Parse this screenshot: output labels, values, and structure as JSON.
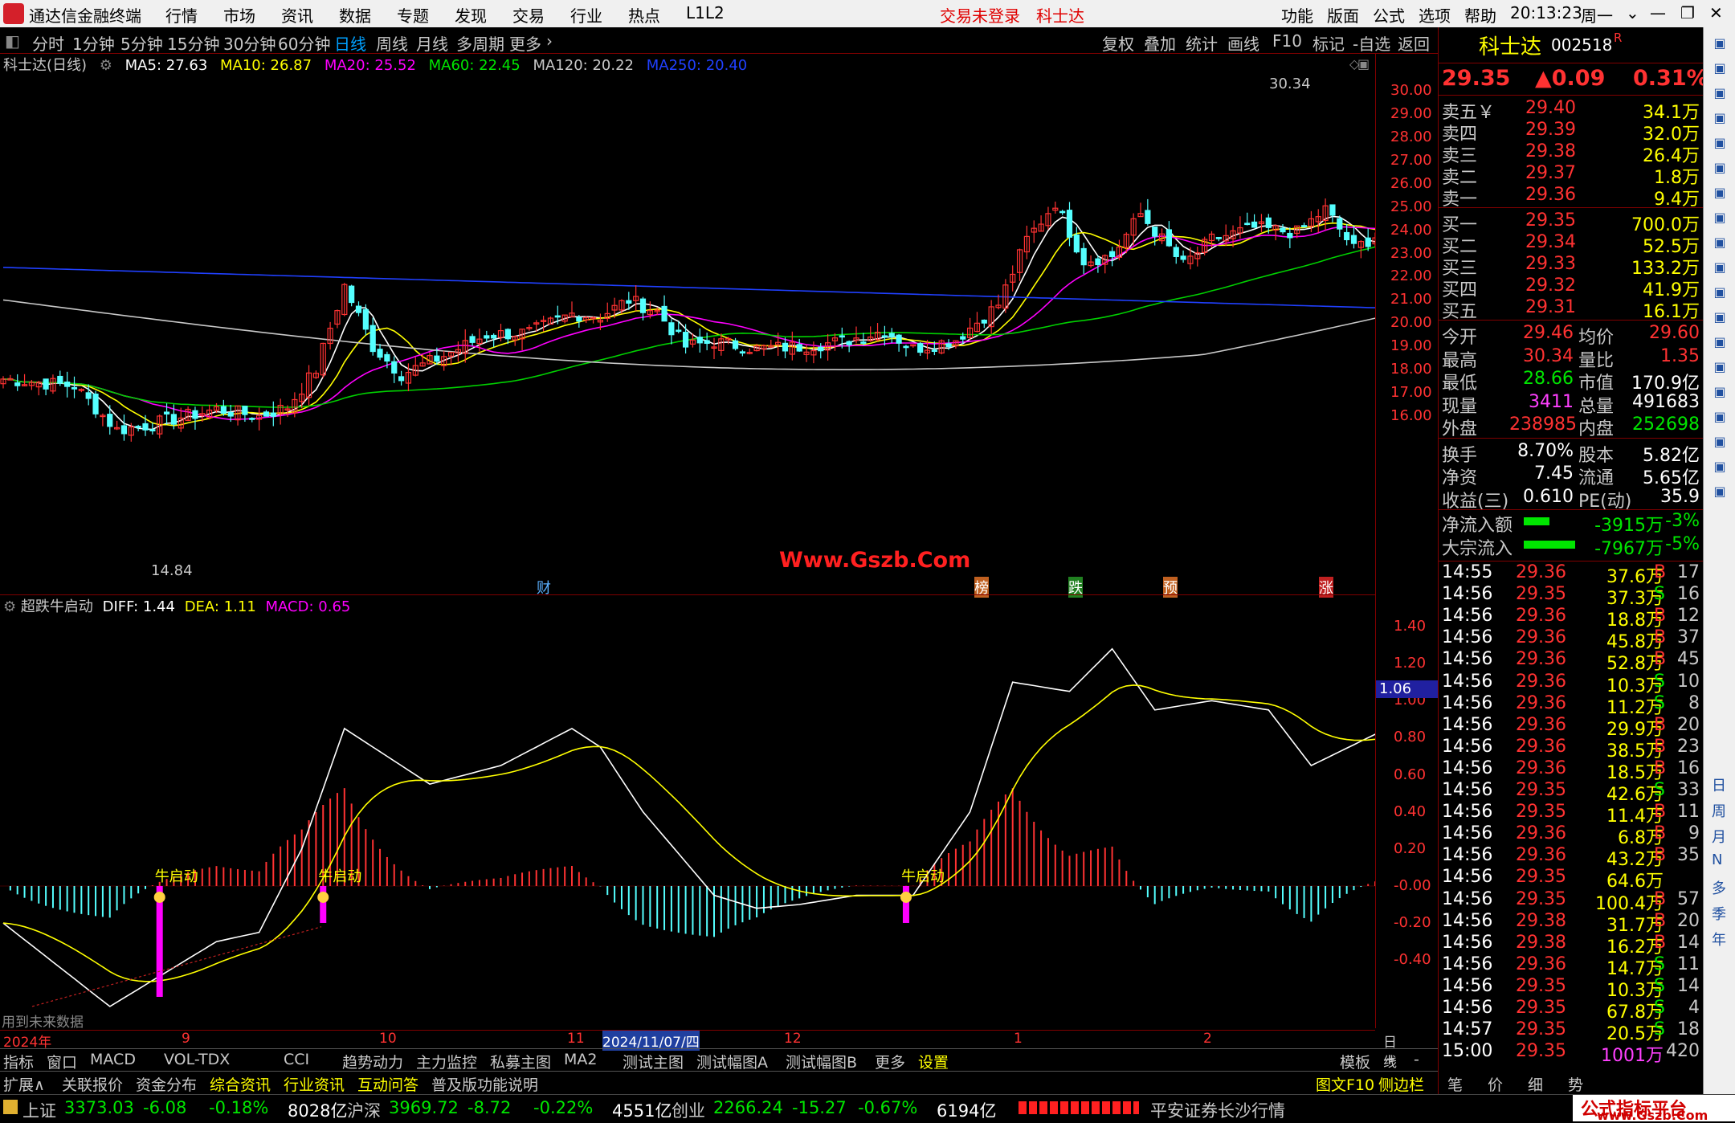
{
  "app": {
    "title": "通达信金融终端",
    "menu": [
      "行情",
      "市场",
      "资讯",
      "数据",
      "专题",
      "发现",
      "交易",
      "行业",
      "热点",
      "L1L2"
    ],
    "status_red": [
      "交易未登录",
      "科士达"
    ],
    "right_menu": [
      "功能",
      "版面",
      "公式",
      "选项",
      "帮助"
    ],
    "time": "20:13:23",
    "weekday": "周一"
  },
  "toolbar": {
    "periods": [
      "分时",
      "1分钟",
      "5分钟",
      "15分钟",
      "30分钟",
      "60分钟",
      "日线",
      "周线",
      "月线",
      "多周期",
      "更多"
    ],
    "active": "日线",
    "tools": [
      "复权",
      "叠加",
      "统计",
      "画线",
      "F10",
      "标记",
      "-自选",
      "返回"
    ]
  },
  "ma": {
    "name": "科士达(日线)",
    "ma5": "MA5: 27.63",
    "ma10": "MA10: 26.87",
    "ma20": "MA20: 25.52",
    "ma60": "MA60: 22.45",
    "ma120": "MA120: 20.22",
    "ma250": "MA250: 20.40"
  },
  "chart": {
    "high_label": "30.34",
    "low_label": "14.84",
    "watermark": "Www.Gszb.Com",
    "price_ticks": [
      "30.00",
      "29.00",
      "28.00",
      "27.00",
      "26.00",
      "25.00",
      "24.00",
      "23.00",
      "22.00",
      "21.00",
      "20.00",
      "19.00",
      "18.00",
      "17.00",
      "16.00"
    ],
    "markers": [
      "财",
      "榜",
      "跌",
      "预",
      "涨"
    ]
  },
  "indicator": {
    "name": "超跌牛启动",
    "diff": "DIFF: 1.44",
    "dea": "DEA: 1.11",
    "macd": "MACD: 0.65",
    "ticks": [
      "1.40",
      "1.20",
      "1.00",
      "0.80",
      "0.60",
      "0.40",
      "0.20",
      "-0.00",
      "-0.20",
      "-0.40"
    ],
    "current": "1.06",
    "signal": "牛启动",
    "footnote": "用到未来数据"
  },
  "dates": {
    "labels": [
      "2024年",
      "9",
      "10",
      "11",
      "2024/11/07/四",
      "12",
      "1",
      "2"
    ],
    "period": "日线"
  },
  "tabs1": [
    "指标",
    "窗口",
    "MACD",
    "VOL-TDX",
    "CCI",
    "趋势动力",
    "主力监控",
    "私募主图",
    "MA2",
    "测试主图",
    "测试幅图A",
    "测试幅图B",
    "更多",
    "设置"
  ],
  "tabs1_right": [
    "模板",
    "+",
    "-"
  ],
  "tabs2": [
    "扩展∧",
    "关联报价",
    "资金分布",
    "综合资讯",
    "行业资讯",
    "互动问答",
    "普及版功能说明"
  ],
  "tabs2_right": [
    "图文F10",
    "侧边栏《",
    "笔",
    "价",
    "细",
    "势"
  ],
  "stock": {
    "name": "科士达",
    "code": "002518",
    "mark": "R",
    "price": "29.35",
    "change": "▲0.09",
    "pct": "0.31%"
  },
  "asks": [
    {
      "l": "卖五￥",
      "p": "29.40",
      "v": "34.1万"
    },
    {
      "l": "卖四",
      "p": "29.39",
      "v": "32.0万"
    },
    {
      "l": "卖三",
      "p": "29.38",
      "v": "26.4万"
    },
    {
      "l": "卖二",
      "p": "29.37",
      "v": "1.8万"
    },
    {
      "l": "卖一",
      "p": "29.36",
      "v": "9.4万"
    }
  ],
  "bids": [
    {
      "l": "买一",
      "p": "29.35",
      "v": "700.0万"
    },
    {
      "l": "买二",
      "p": "29.34",
      "v": "52.5万"
    },
    {
      "l": "买三",
      "p": "29.33",
      "v": "133.2万"
    },
    {
      "l": "买四",
      "p": "29.32",
      "v": "41.9万"
    },
    {
      "l": "买五",
      "p": "29.31",
      "v": "16.1万"
    }
  ],
  "stats": [
    {
      "l1": "今开",
      "v1": "29.46",
      "l2": "均价",
      "v2": "29.60",
      "c1": "red",
      "c2": "red"
    },
    {
      "l1": "最高",
      "v1": "30.34",
      "l2": "量比",
      "v2": "1.35",
      "c1": "red",
      "c2": "red"
    },
    {
      "l1": "最低",
      "v1": "28.66",
      "l2": "市值",
      "v2": "170.9亿",
      "c1": "green",
      "c2": "white"
    },
    {
      "l1": "现量",
      "v1": "3411",
      "l2": "总量",
      "v2": "491683",
      "c1": "magenta",
      "c2": "white"
    },
    {
      "l1": "外盘",
      "v1": "238985",
      "l2": "内盘",
      "v2": "252698",
      "c1": "red",
      "c2": "green"
    },
    {
      "l1": "换手",
      "v1": "8.70%",
      "l2": "股本",
      "v2": "5.82亿",
      "c1": "white",
      "c2": "white"
    },
    {
      "l1": "净资",
      "v1": "7.45",
      "l2": "流通",
      "v2": "5.65亿",
      "c1": "white",
      "c2": "white"
    },
    {
      "l1": "收益(三)",
      "v1": "0.610",
      "l2": "PE(动)",
      "v2": "35.9",
      "c1": "white",
      "c2": "white"
    }
  ],
  "flow": [
    {
      "l": "净流入额",
      "v": "-3915万",
      "p": "-3%"
    },
    {
      "l": "大宗流入",
      "v": "-7967万",
      "p": "-5%"
    }
  ],
  "ticks": [
    [
      "14:55",
      "29.36",
      "37.6万",
      "B",
      "17"
    ],
    [
      "14:56",
      "29.35",
      "37.3万",
      "S",
      "16"
    ],
    [
      "14:56",
      "29.36",
      "18.8万",
      "B",
      "12"
    ],
    [
      "14:56",
      "29.36",
      "45.8万",
      "B",
      "37"
    ],
    [
      "14:56",
      "29.36",
      "52.8万",
      "B",
      "45"
    ],
    [
      "14:56",
      "29.36",
      "10.3万",
      "S",
      "10"
    ],
    [
      "14:56",
      "29.36",
      "11.2万",
      "S",
      "8"
    ],
    [
      "14:56",
      "29.36",
      "29.9万",
      "B",
      "20"
    ],
    [
      "14:56",
      "29.36",
      "38.5万",
      "B",
      "23"
    ],
    [
      "14:56",
      "29.36",
      "18.5万",
      "B",
      "16"
    ],
    [
      "14:56",
      "29.35",
      "42.6万",
      "S",
      "33"
    ],
    [
      "14:56",
      "29.35",
      "11.4万",
      "B",
      "11"
    ],
    [
      "14:56",
      "29.36",
      "6.8万",
      "B",
      "9"
    ],
    [
      "14:56",
      "29.36",
      "43.2万",
      "B",
      "35"
    ],
    [
      "14:56",
      "29.35",
      "64.6万",
      "",
      ""
    ],
    [
      "14:56",
      "29.35",
      "100.4万",
      "B",
      "57"
    ],
    [
      "14:56",
      "29.38",
      "31.7万",
      "B",
      "20"
    ],
    [
      "14:56",
      "29.38",
      "16.2万",
      "B",
      "14"
    ],
    [
      "14:56",
      "29.36",
      "14.7万",
      "S",
      "11"
    ],
    [
      "14:56",
      "29.35",
      "10.3万",
      "S",
      "14"
    ],
    [
      "14:56",
      "29.35",
      "67.8万",
      "S",
      "4"
    ],
    [
      "14:57",
      "29.35",
      "20.5万",
      "S",
      "18"
    ],
    [
      "15:00",
      "29.35",
      "1001万",
      "",
      "420"
    ]
  ],
  "index": [
    {
      "n": "上证",
      "v": "3373.03",
      "c": "-6.08",
      "p": "-0.18%",
      "a": "8028亿"
    },
    {
      "n": "沪深",
      "v": "3969.72",
      "c": "-8.72",
      "p": "-0.22%",
      "a": "4551亿"
    },
    {
      "n": "创业",
      "v": "2266.24",
      "c": "-15.27",
      "p": "-0.67%",
      "a": "6194亿"
    }
  ],
  "broker": "平安证券长沙行情",
  "corner": {
    "t1": "公式指标平台",
    "t2": "www.Gszb.Com"
  },
  "sidebar": [
    "日",
    "周",
    "月",
    "N",
    "多",
    "季",
    "年"
  ]
}
